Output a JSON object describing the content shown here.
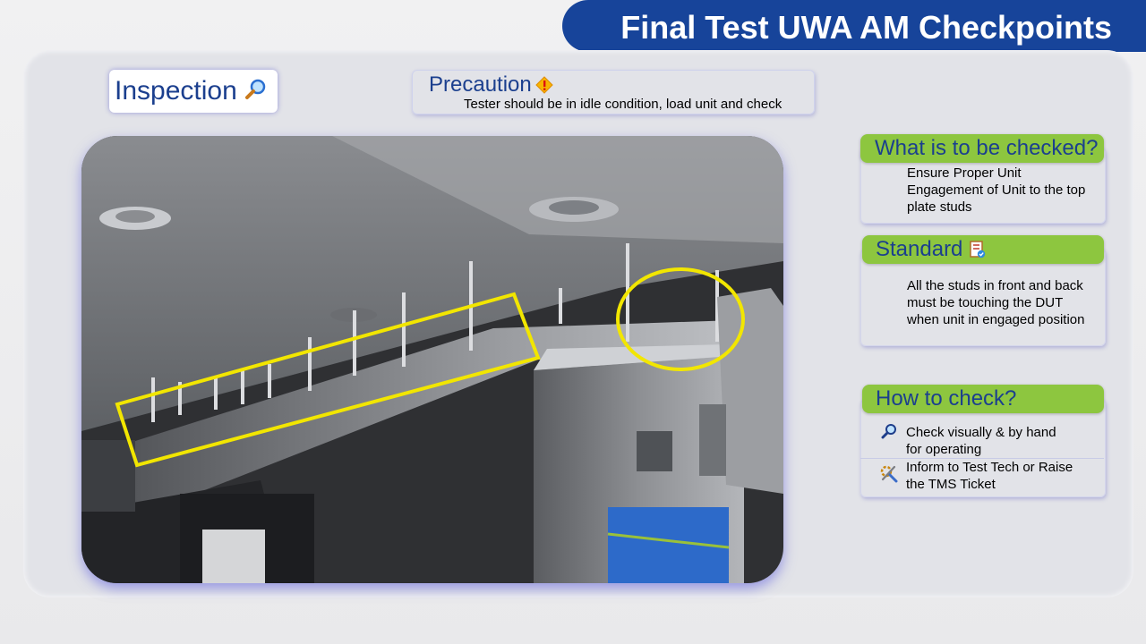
{
  "title": "Final Test UWA AM Checkpoints",
  "inspection": {
    "label": "Inspection",
    "icon": "magnifier-icon"
  },
  "precaution": {
    "label": "Precaution",
    "icon": "warning-icon",
    "text": "Tester should be in idle condition, load unit and check"
  },
  "photo": {
    "icon": "photo-unit-engagement",
    "highlight_color": "#f2e600"
  },
  "what_to_check": {
    "label": "What is to be checked?",
    "lines": [
      "Ensure Proper Unit",
      "Engagement of Unit to the top",
      "plate studs"
    ]
  },
  "standard": {
    "label": "Standard",
    "icon": "checklist-icon",
    "lines": [
      "All the studs in front and back",
      "must be touching the  DUT",
      "when unit in engaged position"
    ]
  },
  "how_to_check": {
    "label": "How to check?",
    "items": [
      {
        "icon": "magnifier-icon",
        "lines": [
          "Check visually & by hand",
          "for operating"
        ]
      },
      {
        "icon": "tools-icon",
        "lines": [
          "Inform to Test Tech or Raise",
          "the TMS Ticket"
        ]
      }
    ]
  },
  "colors": {
    "title_bar": "#17449a",
    "card_head": "#8dc63f",
    "heading_text": "#1b3f8e"
  }
}
